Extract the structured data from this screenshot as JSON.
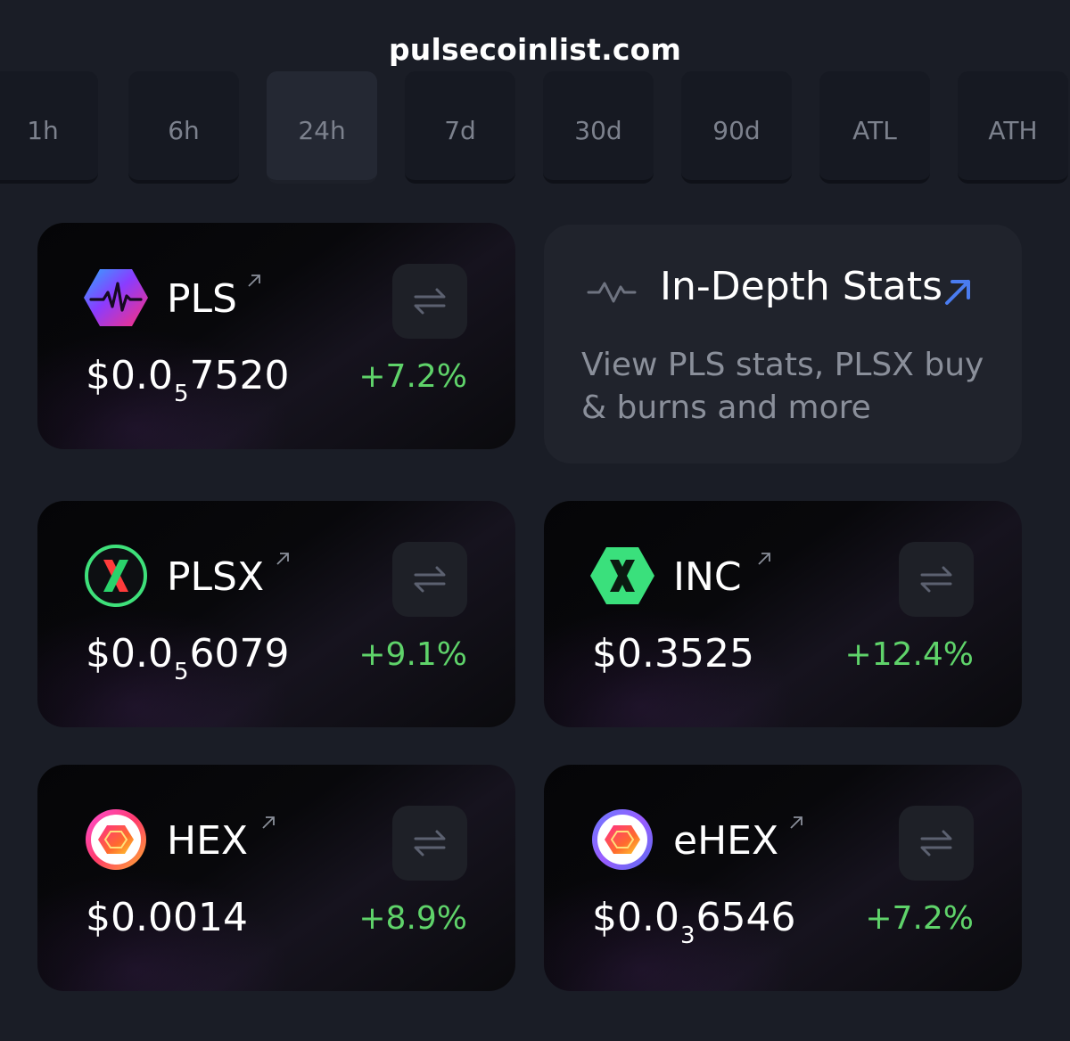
{
  "site": {
    "url": "pulsecoinlist.com"
  },
  "timeframes": [
    "1h",
    "6h",
    "24h",
    "7d",
    "30d",
    "90d",
    "ATL",
    "ATH"
  ],
  "active_timeframe": "24h",
  "stats_card": {
    "title": "In-Depth Stats",
    "description": "View PLS stats, PLSX buy & burns and more"
  },
  "tokens": [
    {
      "symbol": "PLS",
      "price_prefix": "$0.0",
      "zeros": "5",
      "price_digits": "7520",
      "change": "+7.2%",
      "logo": "pls-logo-icon"
    },
    {
      "symbol": "PLSX",
      "price_prefix": "$0.0",
      "zeros": "5",
      "price_digits": "6079",
      "change": "+9.1%",
      "logo": "plsx-logo-icon"
    },
    {
      "symbol": "INC",
      "price": "$0.3525",
      "change": "+12.4%",
      "logo": "inc-logo-icon"
    },
    {
      "symbol": "HEX",
      "price": "$0.0014",
      "change": "+8.9%",
      "logo": "hex-logo-icon"
    },
    {
      "symbol": "eHEX",
      "price_prefix": "$0.0",
      "zeros": "3",
      "price_digits": "6546",
      "change": "+7.2%",
      "logo": "ehex-logo-icon"
    }
  ],
  "colors": {
    "background": "#1a1d26",
    "positive": "#5fd36a",
    "accent_arrow": "#4a7cf0",
    "muted_text": "#8a8f9a"
  }
}
